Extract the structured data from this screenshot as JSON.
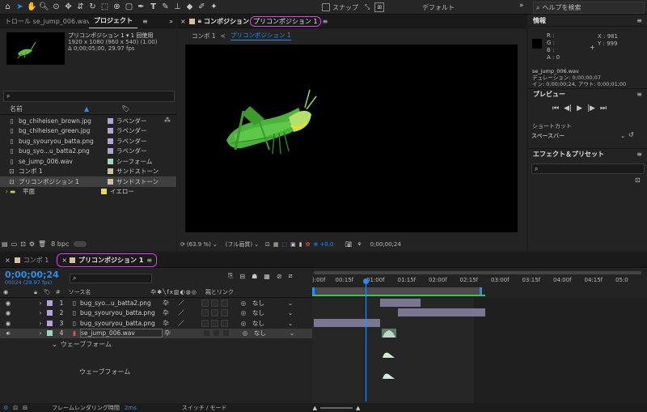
{
  "toolbar": {
    "snap_label": "スナップ",
    "workspace_label": "デフォルト",
    "search_placeholder": "ヘルプを検索",
    "colors": {
      "accent": "#2d8ceb",
      "highlight": "#d546d9"
    }
  },
  "project_panel": {
    "left_tab": "トロール se_jump_006.wav",
    "tab": "プロジェクト",
    "selected_name": "プリコンポジション 1 ▾ 1 回使用",
    "selected_size": "1920 x 1080 (960 x 540) (1.00)",
    "selected_duration": "Δ 0;00;05;00, 29.97 fps",
    "search_placeholder": "",
    "col_name": "名前",
    "items": [
      {
        "name": "bg_chiheisen_brown.jpg",
        "label": "ラベンダー",
        "color": "#b3a4d6",
        "kind": "file"
      },
      {
        "name": "bg_chiheisen_green.jpg",
        "label": "ラベンダー",
        "color": "#b3a4d6",
        "kind": "file"
      },
      {
        "name": "bug_syouryou_batta.png",
        "label": "ラベンダー",
        "color": "#b3a4d6",
        "kind": "file"
      },
      {
        "name": "bug_syo...u_batta2.png",
        "label": "ラベンダー",
        "color": "#b3a4d6",
        "kind": "file"
      },
      {
        "name": "se_jump_006.wav",
        "label": "シーフォーム",
        "color": "#9fd5c3",
        "kind": "file"
      },
      {
        "name": "コンポ 1",
        "label": "サンドストーン",
        "color": "#d3c0a0",
        "kind": "comp"
      },
      {
        "name": "プリコンポジション 1",
        "label": "サンドストーン",
        "color": "#d3c0a0",
        "kind": "comp"
      },
      {
        "name": "平面",
        "label": "イエロー",
        "color": "#e4d85e",
        "kind": "folder"
      }
    ],
    "bpc": "8 bpc"
  },
  "viewer": {
    "tab_label": "コンポジション",
    "tab_highlight": "プリコンポジション 1",
    "crumb_1": "コンポ 1",
    "crumb_sep": "<",
    "crumb_2": "プリコンポジション 1",
    "zoom": "(63.9 %)",
    "quality": "(フル画質)",
    "exposure": "+0.0",
    "timecode": "0;00;00;24"
  },
  "info_panel": {
    "title": "情報",
    "r": "R :",
    "g": "G :",
    "b": "B :",
    "a": "A : 0",
    "x": "X : 981",
    "y": "Y : 999",
    "file": "se_jump_006.wav",
    "duration": "デュレーション: 0;00;00;07",
    "in_out": "イン: 0;00;00;24, アウト: 0;00;01;00"
  },
  "preview_panel": {
    "title": "プレビュー",
    "shortcut_label": "ショートカット",
    "shortcut_value": "スペースバー"
  },
  "effects_panel": {
    "title": "エフェクト＆プリセット",
    "search_placeholder": ""
  },
  "timeline": {
    "tab_1": "コンポ 1",
    "tab_2": "プリコンポジション 1",
    "timecode": "0;00;00;24",
    "fps": "00024 (29.97 fps)",
    "col_source": "ソース名",
    "col_parent": "親とリンク",
    "ruler": [
      "):00f",
      "00:15f",
      "01:00f",
      "01:15f",
      "02:00f",
      "02:15f",
      "03:00f",
      "03:15f",
      "04:00f",
      "04:15f",
      "05:0"
    ],
    "layers": [
      {
        "num": "1",
        "name": "bug_syo...u_batta2.png",
        "parent": "なし",
        "color": "#b3a4d6",
        "icon": "image"
      },
      {
        "num": "2",
        "name": "bug_syouryou_batta.png",
        "parent": "なし",
        "color": "#b3a4d6",
        "icon": "image"
      },
      {
        "num": "3",
        "name": "bug_syouryou_batta.png",
        "parent": "なし",
        "color": "#b3a4d6",
        "icon": "image"
      },
      {
        "num": "4",
        "name": "se_jump_006.wav",
        "parent": "なし",
        "color": "#9fd5c3",
        "icon": "audio"
      }
    ],
    "waveform_group": "ウェーブフォーム",
    "waveform_label": "ウェーブフォーム",
    "render_time_label": "フレームレンダリング時間",
    "render_time_value": "2ms",
    "switch_mode": "スイッチ / モード"
  }
}
